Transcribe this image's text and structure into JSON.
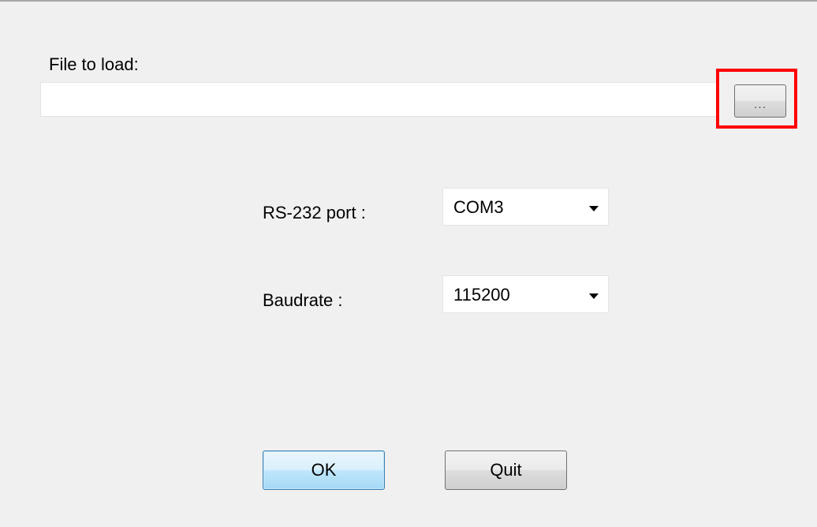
{
  "file": {
    "label": "File to load:",
    "value": "",
    "browse_label": "..."
  },
  "port": {
    "label": "RS-232 port :",
    "selected": "COM3"
  },
  "baudrate": {
    "label": "Baudrate :",
    "selected": "115200"
  },
  "buttons": {
    "ok_label": "OK",
    "quit_label": "Quit"
  },
  "colors": {
    "background": "#f0f0f0",
    "highlight": "#ff0000",
    "ok_button_border": "#3c7fb1"
  }
}
